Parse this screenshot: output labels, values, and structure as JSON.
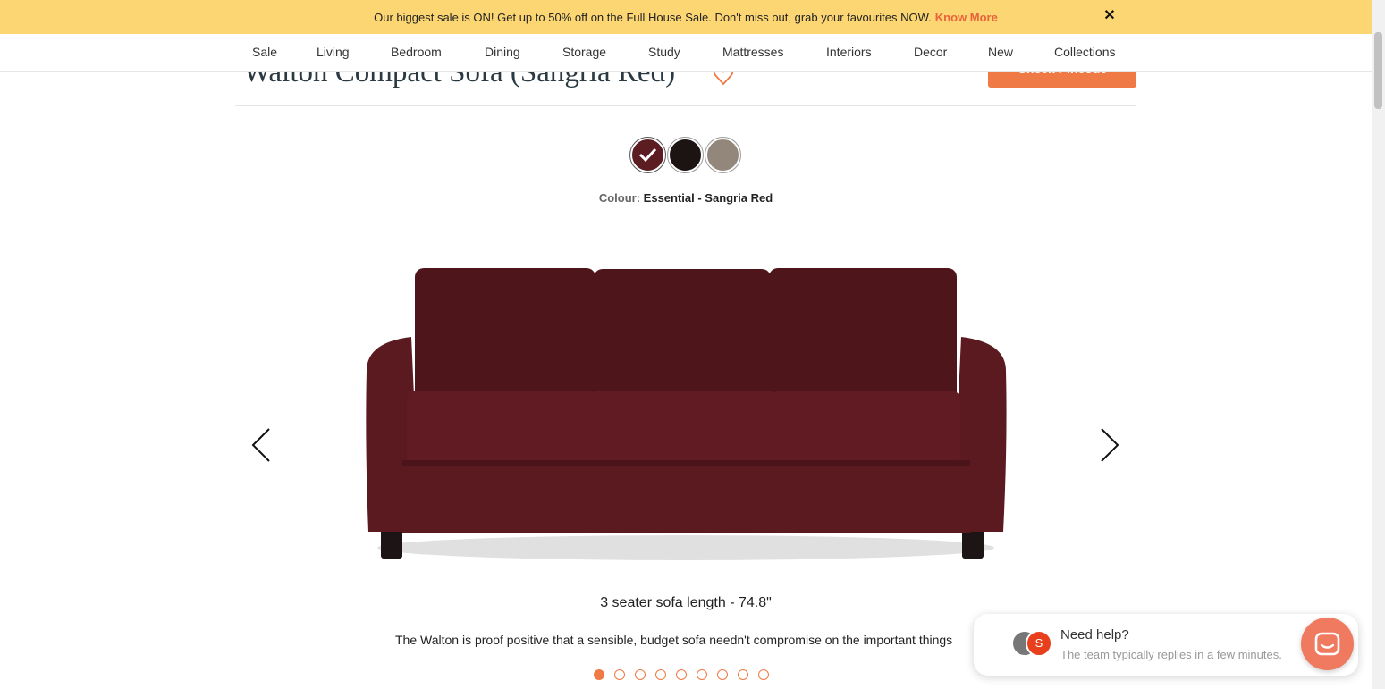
{
  "promo": {
    "text": "Our biggest sale is ON! Get up to 50% off on the Full House Sale. Don't miss out, grab your favourites NOW.",
    "link": "Know More",
    "close": "✕",
    "bg": "#fcd672"
  },
  "nav": {
    "items": [
      "Sale",
      "Living",
      "Bedroom",
      "Dining",
      "Storage",
      "Study",
      "Mattresses",
      "Interiors",
      "Decor",
      "New",
      "Collections"
    ]
  },
  "product": {
    "title": "Walton Compact Sofa (Sangria Red)",
    "cta": "Check Pincode",
    "swatches": [
      "Essential - Sangria Red",
      "Black",
      "Taupe"
    ],
    "colour_label": "Colour:",
    "colour_value": "Essential - Sangria Red",
    "caption": "3 seater sofa length - 74.8\"",
    "description": "The Walton is proof positive that a sensible, budget sofa needn't compromise on the important things",
    "slides_total": 9,
    "slide_active": 1
  },
  "help": {
    "title": "Need help?",
    "subtitle": "The team typically replies in a few minutes.",
    "avatar_initial": "S"
  },
  "colors": {
    "accent": "#ef7a45",
    "sofa": "#5b1a20"
  },
  "icons": {
    "heart": "heart-outline-icon",
    "prev": "chevron-left-icon",
    "next": "chevron-right-icon",
    "chat": "chat-bubble-icon"
  }
}
